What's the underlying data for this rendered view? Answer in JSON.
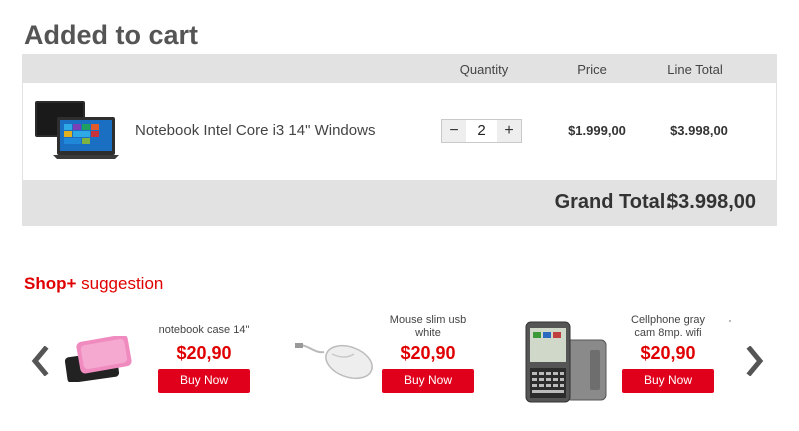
{
  "page": {
    "title": "Added to cart"
  },
  "cart": {
    "columns": {
      "quantity": "Quantity",
      "price": "Price",
      "line_total": "Line Total"
    },
    "items": [
      {
        "name": "Notebook Intel Core i3 14\" Windows",
        "quantity": "2",
        "price": "$1.999,00",
        "line_total": "$3.998,00",
        "icon": "laptop-image"
      }
    ],
    "qty_minus": "−",
    "qty_plus": "+",
    "grand_total_label": "Grand Total:",
    "grand_total_value": "$3.998,00"
  },
  "suggestion": {
    "title_bold": "Shop+",
    "title_rest": " suggestion",
    "products": [
      {
        "name": "notebook case 14\"",
        "price": "$20,90",
        "button": "Buy Now",
        "icon": "laptop-case-image"
      },
      {
        "name": "Mouse slim usb white",
        "price": "$20,90",
        "button": "Buy Now",
        "icon": "mouse-image"
      },
      {
        "name": "Cellphone gray cam 8mp. wifi",
        "price": "$20,90",
        "button": "Buy Now",
        "icon": "phone-image"
      }
    ]
  },
  "colors": {
    "accent": "#e00000",
    "button": "#e0001b",
    "bar": "#e2e2e2",
    "title": "#555555"
  }
}
